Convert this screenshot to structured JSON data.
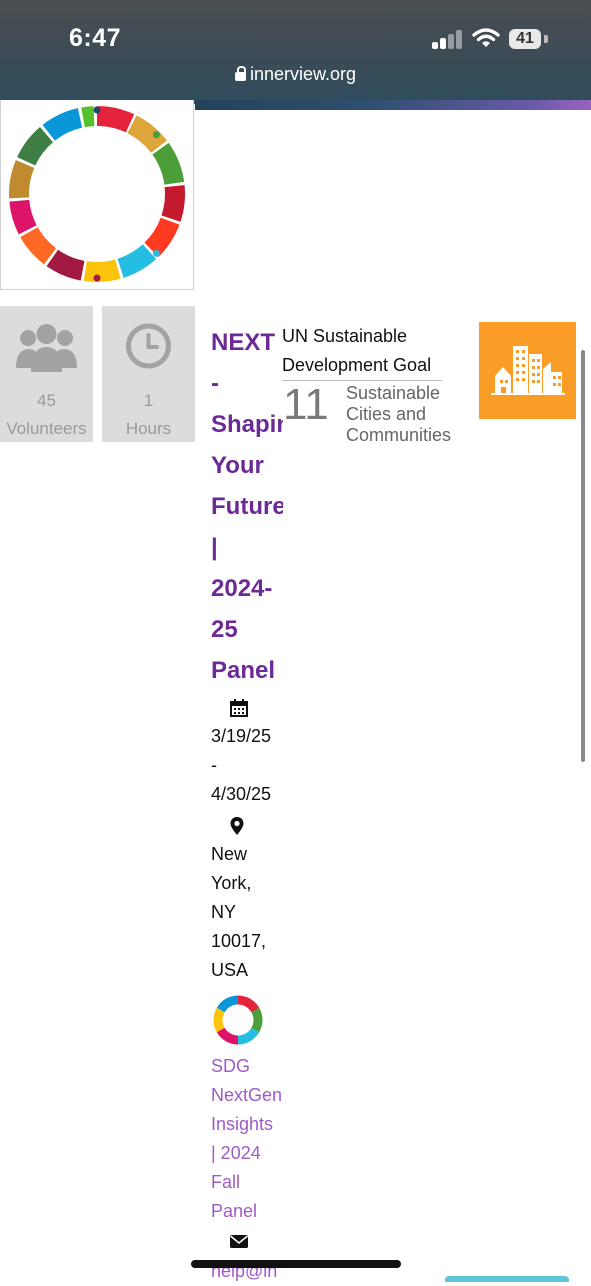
{
  "status_bar": {
    "time": "6:47",
    "battery": "41",
    "url": "innerview.org",
    "icons": [
      "cellular-signal-icon",
      "wifi-icon",
      "battery-icon",
      "lock-icon"
    ]
  },
  "logo": {
    "icon": "sdg-color-wheel-icon"
  },
  "stats": [
    {
      "icon": "volunteers-icon",
      "value": "45",
      "label": "Volunteers"
    },
    {
      "icon": "clock-icon",
      "value": "1",
      "label": "Hours"
    }
  ],
  "event": {
    "title_lines": [
      "NEXT",
      "-",
      "Shapin",
      "Your",
      "Future",
      "|",
      "2024-",
      "25",
      "Panel"
    ],
    "date_lines": [
      "3/19/25",
      "-",
      "4/30/25"
    ],
    "location_lines": [
      "New",
      "York,",
      "NY",
      "10017,",
      "USA"
    ],
    "program_lines": [
      "SDG",
      "NextGen",
      "Insights",
      "| 2024",
      "Fall",
      "Panel"
    ],
    "email_partial": "help@in",
    "icons": [
      "calendar-icon",
      "map-pin-icon",
      "sdg-wheel-icon",
      "envelope-icon"
    ]
  },
  "sdg": {
    "heading_line1": "UN Sustainable",
    "heading_line2": "Development Goal",
    "number": "11",
    "name_lines": [
      "Sustainable",
      "Cities and",
      "Communities"
    ],
    "tile_color": "#f99d26",
    "tile_icon": "city-buildings-icon"
  },
  "colors": {
    "title_purple": "#6c2a97",
    "link_purple": "#a05ac8",
    "stat_bg": "#dcdcdc"
  }
}
